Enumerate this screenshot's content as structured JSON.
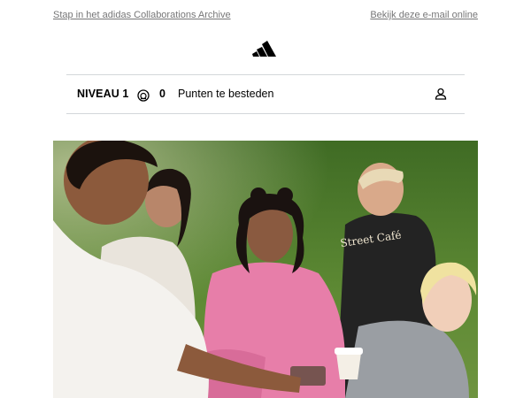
{
  "header": {
    "signup_link": "Stap in het adidas Collaborations Archive",
    "view_online_link": "Bekijk deze e-mail online"
  },
  "logo": {
    "name": "adidas-logo-icon"
  },
  "loyalty_bar": {
    "level": "NIVEAU 1",
    "points_value": "0",
    "points_label": "Punten te besteden",
    "points_icon": "points-icon",
    "account_icon": "user-icon"
  },
  "hero": {
    "shirt_text": "Street Café",
    "description_colors": {
      "grass": "#4f7a2e",
      "pink_sweater": "#e07aa6",
      "white_shirt": "#f2efe9",
      "dark_shirt": "#2a2a2a"
    }
  }
}
